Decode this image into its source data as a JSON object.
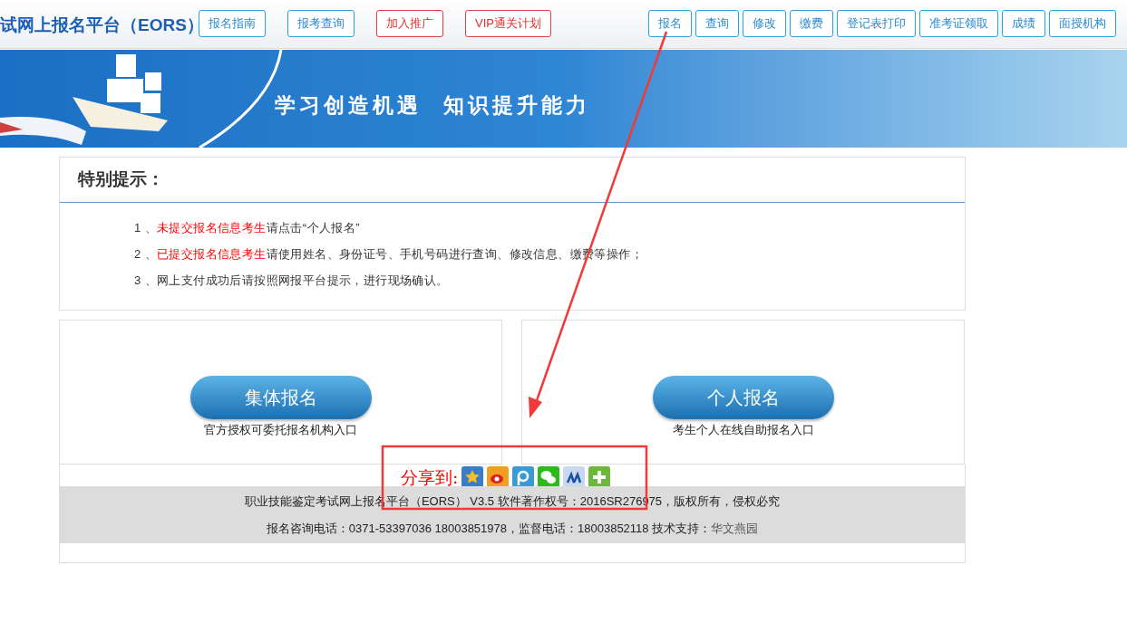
{
  "header": {
    "title": "试网上报名平台（EORS）",
    "left_links": [
      {
        "label": "报名指南",
        "kind": "normal"
      },
      {
        "label": "报考查询",
        "kind": "normal"
      },
      {
        "label": "加入推广",
        "kind": "alert"
      },
      {
        "label": "VIP通关计划",
        "kind": "alert"
      }
    ],
    "right_links": [
      "报名",
      "查询",
      "修改",
      "缴费",
      "登记表打印",
      "准考证领取",
      "成绩",
      "面授机构"
    ]
  },
  "banner": {
    "slogan": "学习创造机遇  知识提升能力"
  },
  "notice": {
    "title": "特别提示：",
    "items": [
      [
        {
          "text": "1 、",
          "highlight": false
        },
        {
          "text": "未提交报名信息考生",
          "highlight": true
        },
        {
          "text": "请点击“个人报名”",
          "highlight": false
        }
      ],
      [
        {
          "text": "2 、",
          "highlight": false
        },
        {
          "text": "已提交报名信息考生",
          "highlight": true
        },
        {
          "text": "请使用姓名、身份证号、手机号码进行查询、修改信息、缴费等操作；",
          "highlight": false
        }
      ],
      [
        {
          "text": "3 、网上支付成功后请按照网报平台提示，进行现场确认。",
          "highlight": false
        }
      ]
    ]
  },
  "entries": [
    {
      "button": "集体报名",
      "caption": "官方授权可委托报名机构入口"
    },
    {
      "button": "个人报名",
      "caption": "考生个人在线自助报名入口"
    }
  ],
  "share": {
    "label": "分享到:"
  },
  "footer": {
    "line1": "职业技能鉴定考试网上报名平台（EORS） V3.5 软件著作权号：2016SR276975，版权所有，侵权必究",
    "line2": "报名咨询电话：0371-53397036 18003851978，监督电话：18003852118  技术支持：",
    "support": "华文燕园"
  }
}
